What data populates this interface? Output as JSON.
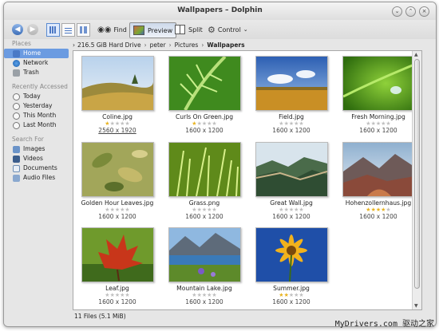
{
  "window": {
    "title": "Wallpapers – Dolphin"
  },
  "toolbar": {
    "find": "Find",
    "preview": "Preview",
    "split": "Split",
    "control": "Control"
  },
  "breadcrumb": [
    "216.5 GiB Hard Drive",
    "peter",
    "Pictures",
    "Wallpapers"
  ],
  "sidebar": {
    "places_header": "Places",
    "places": [
      "Home",
      "Network",
      "Trash"
    ],
    "recent_header": "Recently Accessed",
    "recent": [
      "Today",
      "Yesterday",
      "This Month",
      "Last Month"
    ],
    "search_header": "Search For",
    "search": [
      "Images",
      "Videos",
      "Documents",
      "Audio Files"
    ]
  },
  "files": [
    {
      "name": "Coline.jpg",
      "dims": "2560 x 1920",
      "rating": 1
    },
    {
      "name": "Curls On Green.jpg",
      "dims": "1600 x 1200",
      "rating": 1
    },
    {
      "name": "Field.jpg",
      "dims": "1600 x 1200",
      "rating": 0
    },
    {
      "name": "Fresh Morning.jpg",
      "dims": "1600 x 1200",
      "rating": 0
    },
    {
      "name": "Golden Hour Leaves.jpg",
      "dims": "1600 x 1200",
      "rating": 0
    },
    {
      "name": "Grass.png",
      "dims": "1600 x 1200",
      "rating": 0
    },
    {
      "name": "Great Wall.jpg",
      "dims": "1600 x 1200",
      "rating": 0
    },
    {
      "name": "Hohenzollernhaus.jpg",
      "dims": "1600 x 1200",
      "rating": 4
    },
    {
      "name": "Leaf.jpg",
      "dims": "1600 x 1200",
      "rating": 0
    },
    {
      "name": "Mountain Lake.jpg",
      "dims": "1600 x 1200",
      "rating": 0
    },
    {
      "name": "Summer.jpg",
      "dims": "1600 x 1200",
      "rating": 2
    }
  ],
  "status": {
    "text": "11 Files (5.1 MiB)"
  },
  "watermark": "MyDrivers.com 驱动之家"
}
